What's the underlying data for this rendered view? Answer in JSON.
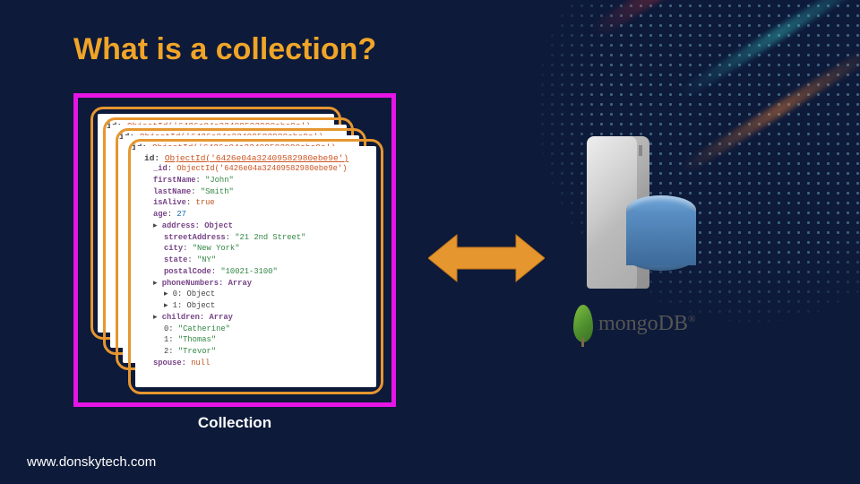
{
  "title": "What is a collection?",
  "collection_label": "Collection",
  "site_url": "www.donskytech.com",
  "brand": {
    "name": "mongoDB",
    "mark": "®"
  },
  "object_id_label": "ObjectId",
  "object_id": "6426e04a32409582980ebe9e",
  "document": {
    "_id_fn": "ObjectId",
    "_id": "6426e04a32409582980ebe9e",
    "firstName": "John",
    "lastName": "Smith",
    "isAlive": "true",
    "age": "27",
    "address_label": "address: Object",
    "address": {
      "streetAddress": "21 2nd Street",
      "city": "New York",
      "state": "NY",
      "postalCode": "10021-3100"
    },
    "phones_label": "phoneNumbers: Array",
    "phones": {
      "p0": "0: Object",
      "p1": "1: Object"
    },
    "children_label": "children: Array",
    "children": {
      "c0": "Catherine",
      "c1": "Thomas",
      "c2": "Trevor"
    },
    "spouse_label": "spouse:",
    "spouse": "null"
  },
  "card_ids": {
    "h0": "ObjectId('6426e04a32409582980ebe9e')",
    "h1": "ObjectId('6426e04a32409582980ebe9e')",
    "h2": "ObjectId('6426e04a32409582980ebe9e')"
  }
}
